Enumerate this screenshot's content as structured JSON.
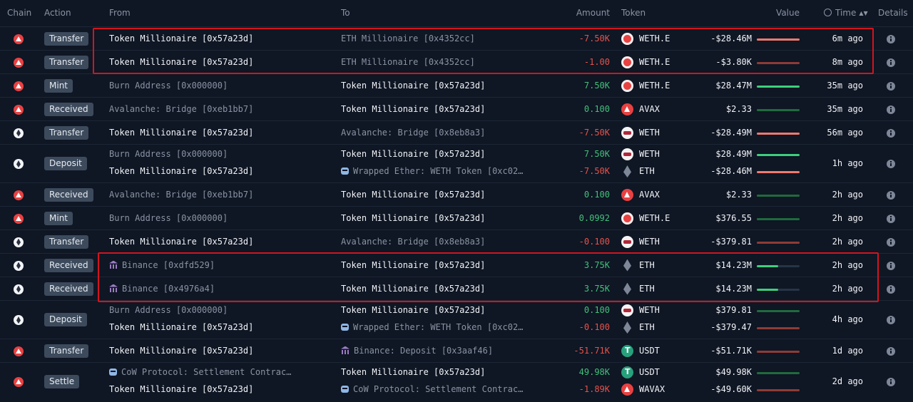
{
  "header": {
    "chain": "Chain",
    "action": "Action",
    "from": "From",
    "to": "To",
    "amount": "Amount",
    "token": "Token",
    "value": "Value",
    "time": "Time",
    "details": "Details"
  },
  "colors": {
    "positive": "#43c07a",
    "negative": "#e5534b",
    "highlight": "#d4141e"
  },
  "rows": [
    {
      "chain": "avalanche",
      "action": "Transfer",
      "lines": [
        {
          "from": "Token Millionaire [0x57a23d]",
          "from_style": "white",
          "to": "ETH Millionaire [0x4352cc]",
          "to_style": "muted",
          "amount": "-7.50K",
          "sign": "neg",
          "token_icon": "weth-e",
          "token": "WETH.E",
          "value": "-$28.46M",
          "bar": 1.0,
          "bar_color": "#f07a6f"
        }
      ],
      "time": "6m ago"
    },
    {
      "chain": "avalanche",
      "action": "Transfer",
      "lines": [
        {
          "from": "Token Millionaire [0x57a23d]",
          "from_style": "white",
          "to": "ETH Millionaire [0x4352cc]",
          "to_style": "muted",
          "amount": "-1.00",
          "sign": "neg",
          "token_icon": "weth-e",
          "token": "WETH.E",
          "value": "-$3.80K",
          "bar": 1.0,
          "bar_color": "#8e3b36"
        }
      ],
      "time": "8m ago"
    },
    {
      "chain": "avalanche",
      "action": "Mint",
      "lines": [
        {
          "from": "Burn Address [0x000000]",
          "from_style": "muted",
          "to": "Token Millionaire [0x57a23d]",
          "to_style": "white",
          "amount": "7.50K",
          "sign": "pos",
          "token_icon": "weth-e",
          "token": "WETH.E",
          "value": "$28.47M",
          "bar": 1.0,
          "bar_color": "#3ecf7c"
        }
      ],
      "time": "35m ago"
    },
    {
      "chain": "avalanche",
      "action": "Received",
      "lines": [
        {
          "from": "Avalanche: Bridge [0xeb1bb7]",
          "from_style": "muted",
          "to": "Token Millionaire [0x57a23d]",
          "to_style": "white",
          "amount": "0.100",
          "sign": "pos",
          "token_icon": "avax",
          "token": "AVAX",
          "value": "$2.33",
          "bar": 1.0,
          "bar_color": "#1f6b3d"
        }
      ],
      "time": "35m ago"
    },
    {
      "chain": "ethereum",
      "action": "Transfer",
      "lines": [
        {
          "from": "Token Millionaire [0x57a23d]",
          "from_style": "white",
          "to": "Avalanche: Bridge [0x8eb8a3]",
          "to_style": "muted",
          "amount": "-7.50K",
          "sign": "neg",
          "token_icon": "weth",
          "token": "WETH",
          "value": "-$28.49M",
          "bar": 1.0,
          "bar_color": "#f07a6f"
        }
      ],
      "time": "56m ago"
    },
    {
      "chain": "ethereum",
      "action": "Deposit",
      "lines": [
        {
          "from": "Burn Address [0x000000]",
          "from_style": "muted",
          "to": "Token Millionaire [0x57a23d]",
          "to_style": "white",
          "amount": "7.50K",
          "sign": "pos",
          "token_icon": "weth",
          "token": "WETH",
          "value": "$28.49M",
          "bar": 1.0,
          "bar_color": "#3ecf7c"
        },
        {
          "from": "Token Millionaire [0x57a23d]",
          "from_style": "white",
          "to_icon": "robot",
          "to": "Wrapped Ether: WETH Token [0xc02…",
          "to_style": "muted",
          "amount": "-7.50K",
          "sign": "neg",
          "token_icon": "eth",
          "token": "ETH",
          "value": "-$28.46M",
          "bar": 1.0,
          "bar_color": "#f07a6f"
        }
      ],
      "time": "1h ago"
    },
    {
      "chain": "avalanche",
      "action": "Received",
      "lines": [
        {
          "from": "Avalanche: Bridge [0xeb1bb7]",
          "from_style": "muted",
          "to": "Token Millionaire [0x57a23d]",
          "to_style": "white",
          "amount": "0.100",
          "sign": "pos",
          "token_icon": "avax",
          "token": "AVAX",
          "value": "$2.33",
          "bar": 1.0,
          "bar_color": "#1f6b3d"
        }
      ],
      "time": "2h ago"
    },
    {
      "chain": "avalanche",
      "action": "Mint",
      "lines": [
        {
          "from": "Burn Address [0x000000]",
          "from_style": "muted",
          "to": "Token Millionaire [0x57a23d]",
          "to_style": "white",
          "amount": "0.0992",
          "sign": "pos",
          "token_icon": "weth-e",
          "token": "WETH.E",
          "value": "$376.55",
          "bar": 1.0,
          "bar_color": "#1f6b3d"
        }
      ],
      "time": "2h ago"
    },
    {
      "chain": "ethereum",
      "action": "Transfer",
      "lines": [
        {
          "from": "Token Millionaire [0x57a23d]",
          "from_style": "white",
          "to": "Avalanche: Bridge [0x8eb8a3]",
          "to_style": "muted",
          "amount": "-0.100",
          "sign": "neg",
          "token_icon": "weth",
          "token": "WETH",
          "value": "-$379.81",
          "bar": 1.0,
          "bar_color": "#8e3b36"
        }
      ],
      "time": "2h ago"
    },
    {
      "chain": "ethereum",
      "action": "Received",
      "lines": [
        {
          "from_icon": "bank",
          "from": "Binance [0xdfd529]",
          "from_style": "muted",
          "to": "Token Millionaire [0x57a23d]",
          "to_style": "white",
          "amount": "3.75K",
          "sign": "pos",
          "token_icon": "eth",
          "token": "ETH",
          "value": "$14.23M",
          "bar": 0.5,
          "bar_color": "#3ecf7c"
        }
      ],
      "time": "2h ago"
    },
    {
      "chain": "ethereum",
      "action": "Received",
      "lines": [
        {
          "from_icon": "bank",
          "from": "Binance [0x4976a4]",
          "from_style": "muted",
          "to": "Token Millionaire [0x57a23d]",
          "to_style": "white",
          "amount": "3.75K",
          "sign": "pos",
          "token_icon": "eth",
          "token": "ETH",
          "value": "$14.23M",
          "bar": 0.5,
          "bar_color": "#3ecf7c"
        }
      ],
      "time": "2h ago"
    },
    {
      "chain": "ethereum",
      "action": "Deposit",
      "lines": [
        {
          "from": "Burn Address [0x000000]",
          "from_style": "muted",
          "to": "Token Millionaire [0x57a23d]",
          "to_style": "white",
          "amount": "0.100",
          "sign": "pos",
          "token_icon": "weth",
          "token": "WETH",
          "value": "$379.81",
          "bar": 1.0,
          "bar_color": "#1f6b3d"
        },
        {
          "from": "Token Millionaire [0x57a23d]",
          "from_style": "white",
          "to_icon": "robot",
          "to": "Wrapped Ether: WETH Token [0xc02…",
          "to_style": "muted",
          "amount": "-0.100",
          "sign": "neg",
          "token_icon": "eth",
          "token": "ETH",
          "value": "-$379.47",
          "bar": 1.0,
          "bar_color": "#8e3b36"
        }
      ],
      "time": "4h ago"
    },
    {
      "chain": "avalanche",
      "action": "Transfer",
      "lines": [
        {
          "from": "Token Millionaire [0x57a23d]",
          "from_style": "white",
          "to_icon": "bank",
          "to": "Binance: Deposit [0x3aaf46]",
          "to_style": "muted",
          "amount": "-51.71K",
          "sign": "neg",
          "token_icon": "usdt",
          "token": "USDT",
          "value": "-$51.71K",
          "bar": 1.0,
          "bar_color": "#8e3b36"
        }
      ],
      "time": "1d ago"
    },
    {
      "chain": "avalanche",
      "action": "Settle",
      "lines": [
        {
          "from_icon": "robot",
          "from": "CoW Protocol: Settlement Contrac…",
          "from_style": "muted",
          "to": "Token Millionaire [0x57a23d]",
          "to_style": "white",
          "amount": "49.98K",
          "sign": "pos",
          "token_icon": "usdt",
          "token": "USDT",
          "value": "$49.98K",
          "bar": 1.0,
          "bar_color": "#1f6b3d"
        },
        {
          "from": "Token Millionaire [0x57a23d]",
          "from_style": "white",
          "to_icon": "robot",
          "to": "CoW Protocol: Settlement Contrac…",
          "to_style": "muted",
          "amount": "-1.89K",
          "sign": "neg",
          "token_icon": "wavax",
          "token": "WAVAX",
          "value": "-$49.60K",
          "bar": 1.0,
          "bar_color": "#8e3b36"
        }
      ],
      "time": "2d ago"
    }
  ]
}
